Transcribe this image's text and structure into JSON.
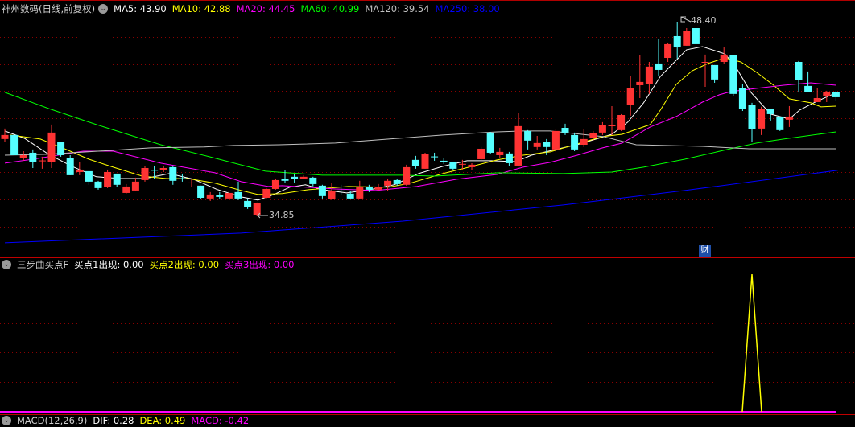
{
  "header": {
    "title": "神州数码(日线,前复权)",
    "ma": [
      {
        "label": "MA5: 43.90",
        "color": "#ffffff"
      },
      {
        "label": "MA10: 42.88",
        "color": "#ffff00"
      },
      {
        "label": "MA20: 44.45",
        "color": "#ff00ff"
      },
      {
        "label": "MA60: 40.99",
        "color": "#00ff00"
      },
      {
        "label": "MA120: 39.54",
        "color": "#c0c0c0"
      },
      {
        "label": "MA250: 38.00",
        "color": "#0000ff"
      }
    ]
  },
  "indicator": {
    "title": "三步曲买点F",
    "items": [
      {
        "label": "买点1出现: 0.00",
        "color": "#ffffff"
      },
      {
        "label": "买点2出现: 0.00",
        "color": "#ffff00"
      },
      {
        "label": "买点3出现: 0.00",
        "color": "#ff00ff"
      }
    ]
  },
  "macd": {
    "title": "MACD(12,26,9)",
    "items": [
      {
        "label": "DIF: 0.28",
        "color": "#ffffff"
      },
      {
        "label": "DEA: 0.49",
        "color": "#ffff00"
      },
      {
        "label": "MACD: -0.42",
        "color": "#ff00ff"
      }
    ]
  },
  "badge": "财",
  "colors": {
    "up": "#ff3333",
    "down": "#55ffff"
  },
  "chart_data": {
    "type": "candlestick",
    "high_label": "48.40",
    "low_label": "34.85",
    "ylim": [
      32.4,
      49.0
    ],
    "ohlc": [
      [
        40.2,
        40.93,
        39.97,
        40.48
      ],
      [
        40.48,
        40.59,
        39.07,
        39.07
      ],
      [
        38.85,
        39.35,
        38.68,
        39.07
      ],
      [
        39.24,
        39.47,
        38.17,
        38.57
      ],
      [
        38.66,
        38.96,
        38.12,
        38.7
      ],
      [
        38.57,
        41.21,
        38.17,
        40.65
      ],
      [
        39.97,
        39.97,
        38.96,
        39.07
      ],
      [
        38.9,
        39.07,
        37.67,
        37.67
      ],
      [
        37.89,
        38.57,
        37.67,
        38.06
      ],
      [
        37.95,
        37.95,
        37.0,
        37.22
      ],
      [
        37.22,
        37.28,
        36.66,
        36.77
      ],
      [
        36.83,
        38.06,
        36.77,
        37.89
      ],
      [
        37.78,
        37.78,
        36.83,
        37.0
      ],
      [
        36.43,
        37.05,
        36.38,
        36.88
      ],
      [
        36.6,
        37.5,
        36.6,
        37.22
      ],
      [
        37.33,
        38.29,
        37.22,
        38.17
      ],
      [
        38.04,
        38.34,
        37.44,
        38.0
      ],
      [
        38.06,
        38.34,
        37.89,
        38.17
      ],
      [
        38.23,
        38.34,
        37.0,
        37.28
      ],
      [
        37.46,
        37.78,
        37.22,
        37.44
      ],
      [
        37.14,
        37.44,
        36.88,
        37.16
      ],
      [
        36.94,
        36.94,
        36.04,
        36.09
      ],
      [
        36.04,
        36.49,
        35.87,
        36.32
      ],
      [
        36.26,
        36.49,
        36.04,
        36.15
      ],
      [
        36.04,
        36.54,
        35.98,
        36.43
      ],
      [
        36.49,
        37.22,
        35.93,
        36.04
      ],
      [
        35.87,
        36.04,
        35.31,
        35.42
      ],
      [
        34.91,
        35.76,
        34.85,
        35.7
      ],
      [
        36.09,
        36.77,
        35.98,
        36.71
      ],
      [
        36.71,
        37.44,
        36.66,
        37.33
      ],
      [
        37.39,
        38.01,
        37.16,
        37.28
      ],
      [
        37.56,
        37.72,
        37.16,
        37.39
      ],
      [
        37.44,
        37.67,
        37.39,
        37.56
      ],
      [
        37.5,
        37.56,
        36.88,
        37.05
      ],
      [
        36.94,
        37.0,
        36.04,
        36.21
      ],
      [
        35.98,
        37.11,
        35.93,
        36.6
      ],
      [
        36.6,
        37.0,
        36.26,
        36.54
      ],
      [
        36.38,
        36.54,
        35.98,
        36.04
      ],
      [
        36.04,
        37.28,
        35.98,
        36.83
      ],
      [
        36.83,
        37.0,
        36.49,
        36.66
      ],
      [
        36.66,
        37.05,
        36.54,
        36.83
      ],
      [
        36.94,
        37.44,
        36.54,
        37.28
      ],
      [
        37.33,
        37.44,
        36.94,
        37.05
      ],
      [
        37.0,
        38.4,
        36.94,
        38.23
      ],
      [
        38.74,
        39.02,
        38.12,
        38.29
      ],
      [
        38.12,
        39.24,
        38.12,
        39.13
      ],
      [
        38.98,
        39.24,
        38.68,
        38.94
      ],
      [
        38.68,
        38.85,
        38.46,
        38.57
      ],
      [
        38.62,
        38.62,
        38.01,
        38.12
      ],
      [
        38.44,
        38.74,
        38.01,
        38.46
      ],
      [
        38.23,
        38.51,
        38.01,
        38.4
      ],
      [
        38.79,
        39.64,
        38.68,
        39.52
      ],
      [
        40.65,
        40.7,
        39.13,
        39.24
      ],
      [
        39.07,
        39.58,
        38.85,
        39.3
      ],
      [
        39.19,
        39.3,
        38.34,
        38.51
      ],
      [
        38.34,
        42.05,
        38.34,
        41.1
      ],
      [
        40.76,
        40.82,
        39.47,
        40.09
      ],
      [
        39.64,
        40.42,
        39.47,
        39.92
      ],
      [
        39.97,
        40.2,
        39.07,
        39.64
      ],
      [
        39.47,
        40.87,
        39.3,
        40.76
      ],
      [
        40.98,
        41.27,
        40.48,
        40.65
      ],
      [
        40.48,
        40.65,
        39.35,
        39.47
      ],
      [
        39.8,
        40.87,
        39.64,
        40.2
      ],
      [
        40.25,
        40.76,
        40.09,
        40.59
      ],
      [
        40.65,
        41.38,
        40.48,
        41.15
      ],
      [
        41.13,
        42.5,
        40.48,
        41.15
      ],
      [
        40.82,
        41.94,
        40.76,
        41.88
      ],
      [
        42.56,
        44.58,
        41.83,
        43.79
      ],
      [
        43.96,
        46.04,
        43.06,
        44.19
      ],
      [
        44.02,
        45.59,
        43.35,
        45.26
      ],
      [
        45.48,
        47.22,
        44.58,
        45.03
      ],
      [
        45.87,
        46.94,
        45.59,
        46.83
      ],
      [
        47.39,
        48.4,
        45.82,
        46.6
      ],
      [
        46.72,
        47.95,
        46.72,
        47.78
      ],
      [
        47.95,
        47.95,
        46.83,
        46.83
      ],
      [
        45.57,
        46.1,
        43.85,
        45.59
      ],
      [
        45.37,
        45.37,
        44.13,
        44.36
      ],
      [
        45.59,
        46.6,
        45.42,
        46.1
      ],
      [
        46.04,
        46.04,
        43.18,
        43.35
      ],
      [
        43.74,
        44.02,
        42.16,
        42.28
      ],
      [
        42.61,
        42.73,
        39.97,
        40.87
      ],
      [
        40.93,
        42.45,
        40.48,
        42.28
      ],
      [
        42.33,
        42.33,
        41.49,
        41.94
      ],
      [
        41.77,
        41.77,
        40.76,
        40.82
      ],
      [
        41.55,
        42.5,
        41.04,
        41.77
      ],
      [
        45.59,
        45.65,
        43.46,
        44.3
      ],
      [
        43.91,
        44.92,
        43.46,
        43.46
      ],
      [
        42.78,
        43.79,
        42.78,
        43.06
      ],
      [
        43.18,
        43.57,
        42.78,
        43.46
      ],
      [
        43.46,
        43.57,
        42.84,
        43.12
      ]
    ],
    "ma_lines": [
      {
        "name": "MA5",
        "color": "#ffffff",
        "points": [
          [
            0,
            40.76
          ],
          [
            2.1,
            40.25
          ],
          [
            4.7,
            39.13
          ],
          [
            7.2,
            38.29
          ],
          [
            9.8,
            37.56
          ],
          [
            12.4,
            37.44
          ],
          [
            15,
            37.44
          ],
          [
            17.6,
            37.78
          ],
          [
            20.2,
            37.39
          ],
          [
            22.8,
            36.66
          ],
          [
            25.3,
            36.15
          ],
          [
            27.1,
            35.93
          ],
          [
            28.8,
            36.32
          ],
          [
            30.5,
            36.83
          ],
          [
            32.2,
            37.0
          ],
          [
            34,
            36.66
          ],
          [
            36.6,
            36.43
          ],
          [
            39.1,
            36.66
          ],
          [
            41.7,
            37.0
          ],
          [
            44.3,
            37.78
          ],
          [
            46.9,
            38.29
          ],
          [
            49.5,
            38.68
          ],
          [
            52.1,
            38.68
          ],
          [
            54.7,
            38.62
          ],
          [
            56.4,
            39.07
          ],
          [
            59,
            39.47
          ],
          [
            61.6,
            39.86
          ],
          [
            63.3,
            40.2
          ],
          [
            65,
            40.53
          ],
          [
            66.7,
            41.38
          ],
          [
            68.4,
            42.73
          ],
          [
            70.2,
            44.58
          ],
          [
            71.9,
            45.71
          ],
          [
            73,
            46.44
          ],
          [
            74.7,
            46.66
          ],
          [
            77.1,
            46.15
          ],
          [
            78.2,
            45.31
          ],
          [
            79.9,
            43.46
          ],
          [
            82,
            41.94
          ],
          [
            84,
            41.6
          ],
          [
            85.1,
            42.22
          ],
          [
            86.6,
            42.73
          ],
          [
            89.1,
            43.46
          ]
        ]
      },
      {
        "name": "MA10",
        "color": "#ffff00",
        "points": [
          [
            0.6,
            40.48
          ],
          [
            3.8,
            40.2
          ],
          [
            6.4,
            39.52
          ],
          [
            9,
            38.79
          ],
          [
            11.6,
            38.23
          ],
          [
            14.7,
            37.61
          ],
          [
            17.3,
            37.44
          ],
          [
            19.6,
            37.44
          ],
          [
            22.5,
            37.11
          ],
          [
            25.3,
            36.6
          ],
          [
            27.1,
            36.32
          ],
          [
            29.7,
            36.38
          ],
          [
            32.5,
            36.66
          ],
          [
            36.8,
            36.88
          ],
          [
            41.1,
            36.83
          ],
          [
            43.4,
            37.11
          ],
          [
            46.9,
            37.78
          ],
          [
            49.7,
            38.23
          ],
          [
            52.7,
            38.74
          ],
          [
            55.5,
            39.07
          ],
          [
            58.4,
            39.3
          ],
          [
            61.3,
            39.86
          ],
          [
            64,
            40.37
          ],
          [
            66.1,
            40.53
          ],
          [
            69.1,
            41.21
          ],
          [
            70.2,
            42.22
          ],
          [
            71.9,
            44.02
          ],
          [
            73.6,
            44.97
          ],
          [
            75.3,
            45.48
          ],
          [
            77.1,
            45.87
          ],
          [
            78.8,
            45.59
          ],
          [
            80.5,
            44.86
          ],
          [
            82.2,
            44.02
          ],
          [
            84,
            43.01
          ],
          [
            86.3,
            42.73
          ],
          [
            87.4,
            42.45
          ],
          [
            89,
            42.5
          ]
        ]
      },
      {
        "name": "MA20",
        "color": "#ff00ff",
        "points": [
          [
            0,
            38.51
          ],
          [
            3,
            38.79
          ],
          [
            8.4,
            39.35
          ],
          [
            11.6,
            39.35
          ],
          [
            16.7,
            38.51
          ],
          [
            22.5,
            37.84
          ],
          [
            25.3,
            37.22
          ],
          [
            28.2,
            36.88
          ],
          [
            29.7,
            36.94
          ],
          [
            35.4,
            36.71
          ],
          [
            39.7,
            36.6
          ],
          [
            44.1,
            36.88
          ],
          [
            48.4,
            37.39
          ],
          [
            52.7,
            37.72
          ],
          [
            55.5,
            38.23
          ],
          [
            58.4,
            38.57
          ],
          [
            61.3,
            39.07
          ],
          [
            64,
            39.58
          ],
          [
            66.1,
            39.92
          ],
          [
            69.1,
            41.04
          ],
          [
            71.9,
            41.77
          ],
          [
            74.7,
            42.78
          ],
          [
            76.5,
            43.29
          ],
          [
            77.7,
            43.51
          ],
          [
            80.5,
            43.74
          ],
          [
            83.4,
            43.96
          ],
          [
            86.3,
            44.13
          ],
          [
            89,
            43.96
          ]
        ]
      },
      {
        "name": "MA60",
        "color": "#00ff00",
        "points": [
          [
            0,
            43.46
          ],
          [
            4.7,
            42.33
          ],
          [
            9.8,
            41.21
          ],
          [
            16.7,
            39.8
          ],
          [
            21.9,
            38.96
          ],
          [
            27.9,
            37.95
          ],
          [
            34,
            37.67
          ],
          [
            42.6,
            37.67
          ],
          [
            46,
            37.61
          ],
          [
            52.9,
            37.84
          ],
          [
            59.8,
            37.78
          ],
          [
            65,
            37.89
          ],
          [
            68.4,
            38.23
          ],
          [
            72.8,
            38.79
          ],
          [
            77.7,
            39.52
          ],
          [
            80.5,
            39.92
          ],
          [
            83.4,
            40.2
          ],
          [
            89,
            40.7
          ]
        ]
      },
      {
        "name": "MA120",
        "color": "#c0c0c0",
        "points": [
          [
            0,
            39.07
          ],
          [
            4.5,
            39.13
          ],
          [
            11.6,
            39.41
          ],
          [
            15.6,
            39.58
          ],
          [
            21.3,
            39.64
          ],
          [
            24.5,
            39.75
          ],
          [
            29.4,
            39.8
          ],
          [
            35.4,
            39.92
          ],
          [
            41.1,
            40.2
          ],
          [
            46.9,
            40.48
          ],
          [
            52.7,
            40.7
          ],
          [
            55.5,
            40.76
          ],
          [
            58.4,
            40.76
          ],
          [
            64.1,
            40.37
          ],
          [
            67.6,
            39.8
          ],
          [
            74.7,
            39.69
          ],
          [
            79.7,
            39.52
          ],
          [
            89,
            39.52
          ]
        ]
      },
      {
        "name": "MA250",
        "color": "#0000ff",
        "points": [
          [
            0,
            32.95
          ],
          [
            25.3,
            33.62
          ],
          [
            42.6,
            34.46
          ],
          [
            59.8,
            35.59
          ],
          [
            72.8,
            36.6
          ],
          [
            89.2,
            38.01
          ]
        ]
      }
    ],
    "indicator_series": [
      {
        "name": "买点1出现",
        "color": "#ffffff",
        "signal_index": null
      },
      {
        "name": "买点3出现",
        "color": "#ff00ff",
        "signal_index": null
      },
      {
        "name": "买点2出现",
        "color": "#ffff00",
        "signal_index": 80
      }
    ],
    "indicator_ylim": [
      0,
      1
    ]
  }
}
